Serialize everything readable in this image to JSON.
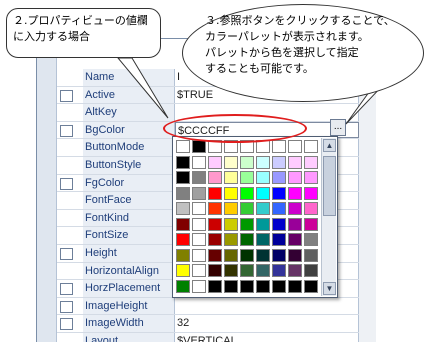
{
  "callouts": {
    "value_input": "２.プロパティビューの値欄に入力する場合",
    "palette_info": [
      "３.参照ボタンをクリックすることで、",
      "カラーパレットが表示されます。",
      "パレットから色を選択して指定",
      "することも可能です。"
    ]
  },
  "property_grid": {
    "rows": [
      {
        "name": "Name",
        "value": "I",
        "checkbox": false
      },
      {
        "name": "Active",
        "value": "$TRUE",
        "checkbox": true
      },
      {
        "name": "AltKey",
        "value": "",
        "checkbox": false
      },
      {
        "name": "BgColor",
        "value": "$CCCCFF",
        "checkbox": true
      },
      {
        "name": "ButtonMode",
        "value": "",
        "checkbox": false
      },
      {
        "name": "ButtonStyle",
        "value": "",
        "checkbox": false
      },
      {
        "name": "FgColor",
        "value": "",
        "checkbox": true
      },
      {
        "name": "FontFace",
        "value": "",
        "checkbox": false
      },
      {
        "name": "FontKind",
        "value": "",
        "checkbox": false
      },
      {
        "name": "FontSize",
        "value": "",
        "checkbox": false
      },
      {
        "name": "Height",
        "value": "",
        "checkbox": true
      },
      {
        "name": "HorizontalAlign",
        "value": "",
        "checkbox": false
      },
      {
        "name": "HorzPlacement",
        "value": "",
        "checkbox": true
      },
      {
        "name": "ImageHeight",
        "value": "",
        "checkbox": true
      },
      {
        "name": "ImageWidth",
        "value": "32",
        "checkbox": true
      },
      {
        "name": "Layout",
        "value": "$VERTICAL",
        "checkbox": false
      }
    ],
    "browse_button_label": "..."
  },
  "palette": {
    "colors": [
      [
        "#ffffff",
        "#000000",
        "#ffffff",
        "#ffffff",
        "#ffffff",
        "#ffffff",
        "#ffffff",
        "#ffffff",
        "#ffffff"
      ],
      [
        "#000000",
        "#ffffff",
        "#ffccff",
        "#ffffcc",
        "#ccffcc",
        "#ccffff",
        "#ccccff",
        "#ffccff",
        "#ffccff"
      ],
      [
        "#000000",
        "#808080",
        "#ff99cc",
        "#ffff99",
        "#99ff99",
        "#99ffff",
        "#9999ff",
        "#ff99ff",
        "#ff99ff"
      ],
      [
        "#808080",
        "#a0a0a0",
        "#ff0000",
        "#ffff00",
        "#00ff00",
        "#00ffff",
        "#0000ff",
        "#ff00ff",
        "#ff00ff"
      ],
      [
        "#c0c0c0",
        "#ffffff",
        "#ff3300",
        "#ffcc00",
        "#33cc33",
        "#33cccc",
        "#3366ff",
        "#cc00cc",
        "#ff66cc"
      ],
      [
        "#800000",
        "#ffffff",
        "#cc0000",
        "#cccc00",
        "#009900",
        "#009999",
        "#0000cc",
        "#990099",
        "#cc0099"
      ],
      [
        "#ff0000",
        "#ffffff",
        "#990000",
        "#999900",
        "#006600",
        "#006666",
        "#000099",
        "#660066",
        "#808080"
      ],
      [
        "#808000",
        "#ffffff",
        "#660000",
        "#666600",
        "#003300",
        "#003333",
        "#000066",
        "#330033",
        "#606060"
      ],
      [
        "#ffff00",
        "#ffffff",
        "#330000",
        "#333300",
        "#336633",
        "#336666",
        "#333399",
        "#663366",
        "#404040"
      ],
      [
        "#008000",
        "#ffffff",
        "#000000",
        "#000000",
        "#000000",
        "#000000",
        "#000000",
        "#000000",
        "#000000"
      ]
    ],
    "scroll_up_label": "▲",
    "scroll_down_label": "▼"
  }
}
